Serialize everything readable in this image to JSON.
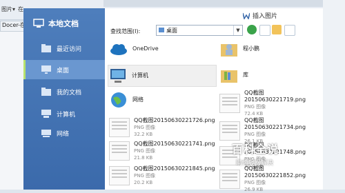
{
  "background": {
    "menu_left": "图片▾",
    "menu_second": "在",
    "doc_tab": "Docer-在"
  },
  "nav": {
    "title": "本地文档",
    "items": [
      {
        "label": "最近访问",
        "icon": "recent-folder-icon",
        "active": false
      },
      {
        "label": "桌面",
        "icon": "desktop-monitor-icon",
        "active": true
      },
      {
        "label": "我的文档",
        "icon": "documents-folder-icon",
        "active": false
      },
      {
        "label": "计算机",
        "icon": "computer-icon",
        "active": false
      },
      {
        "label": "网络",
        "icon": "network-icon",
        "active": false
      }
    ]
  },
  "dialog": {
    "title": "插入图片",
    "look_in_label": "查找范围(I):",
    "location": "桌面"
  },
  "files": [
    {
      "name": "OneDrive",
      "type": "",
      "size": "",
      "icon": "onedrive-cloud-icon"
    },
    {
      "name": "程小鹏",
      "type": "",
      "size": "",
      "icon": "user-folder-icon"
    },
    {
      "name": "计算机",
      "type": "",
      "size": "",
      "icon": "computer-icon"
    },
    {
      "name": "库",
      "type": "",
      "size": "",
      "icon": "library-folder-icon"
    },
    {
      "name": "网络",
      "type": "",
      "size": "",
      "icon": "network-globe-icon"
    },
    {
      "name": "QQ截图20150630221719.png",
      "type": "PNG 图像",
      "size": "72.4 KB",
      "icon": "image-thumbnail-icon"
    },
    {
      "name": "QQ截图20150630221726.png",
      "type": "PNG 图像",
      "size": "32.2 KB",
      "icon": "image-thumbnail-icon"
    },
    {
      "name": "QQ截图20150630221734.png",
      "type": "PNG 图像",
      "size": "26.1 KB",
      "icon": "image-thumbnail-icon"
    },
    {
      "name": "QQ截图20150630221741.png",
      "type": "PNG 图像",
      "size": "21.8 KB",
      "icon": "image-thumbnail-icon"
    },
    {
      "name": "QQ截图20150630221748.png",
      "type": "PNG 图像",
      "size": "30.4 KB",
      "icon": "image-thumbnail-icon"
    },
    {
      "name": "QQ截图20150630221845.png",
      "type": "PNG 图像",
      "size": "20.2 KB",
      "icon": "image-thumbnail-icon"
    },
    {
      "name": "QQ截图20150630221852.png",
      "type": "PNG 图像",
      "size": "26.9 KB",
      "icon": "image-thumbnail-icon"
    }
  ],
  "watermark": {
    "title": "百科全说",
    "subtitle": "助你轻松解决"
  }
}
